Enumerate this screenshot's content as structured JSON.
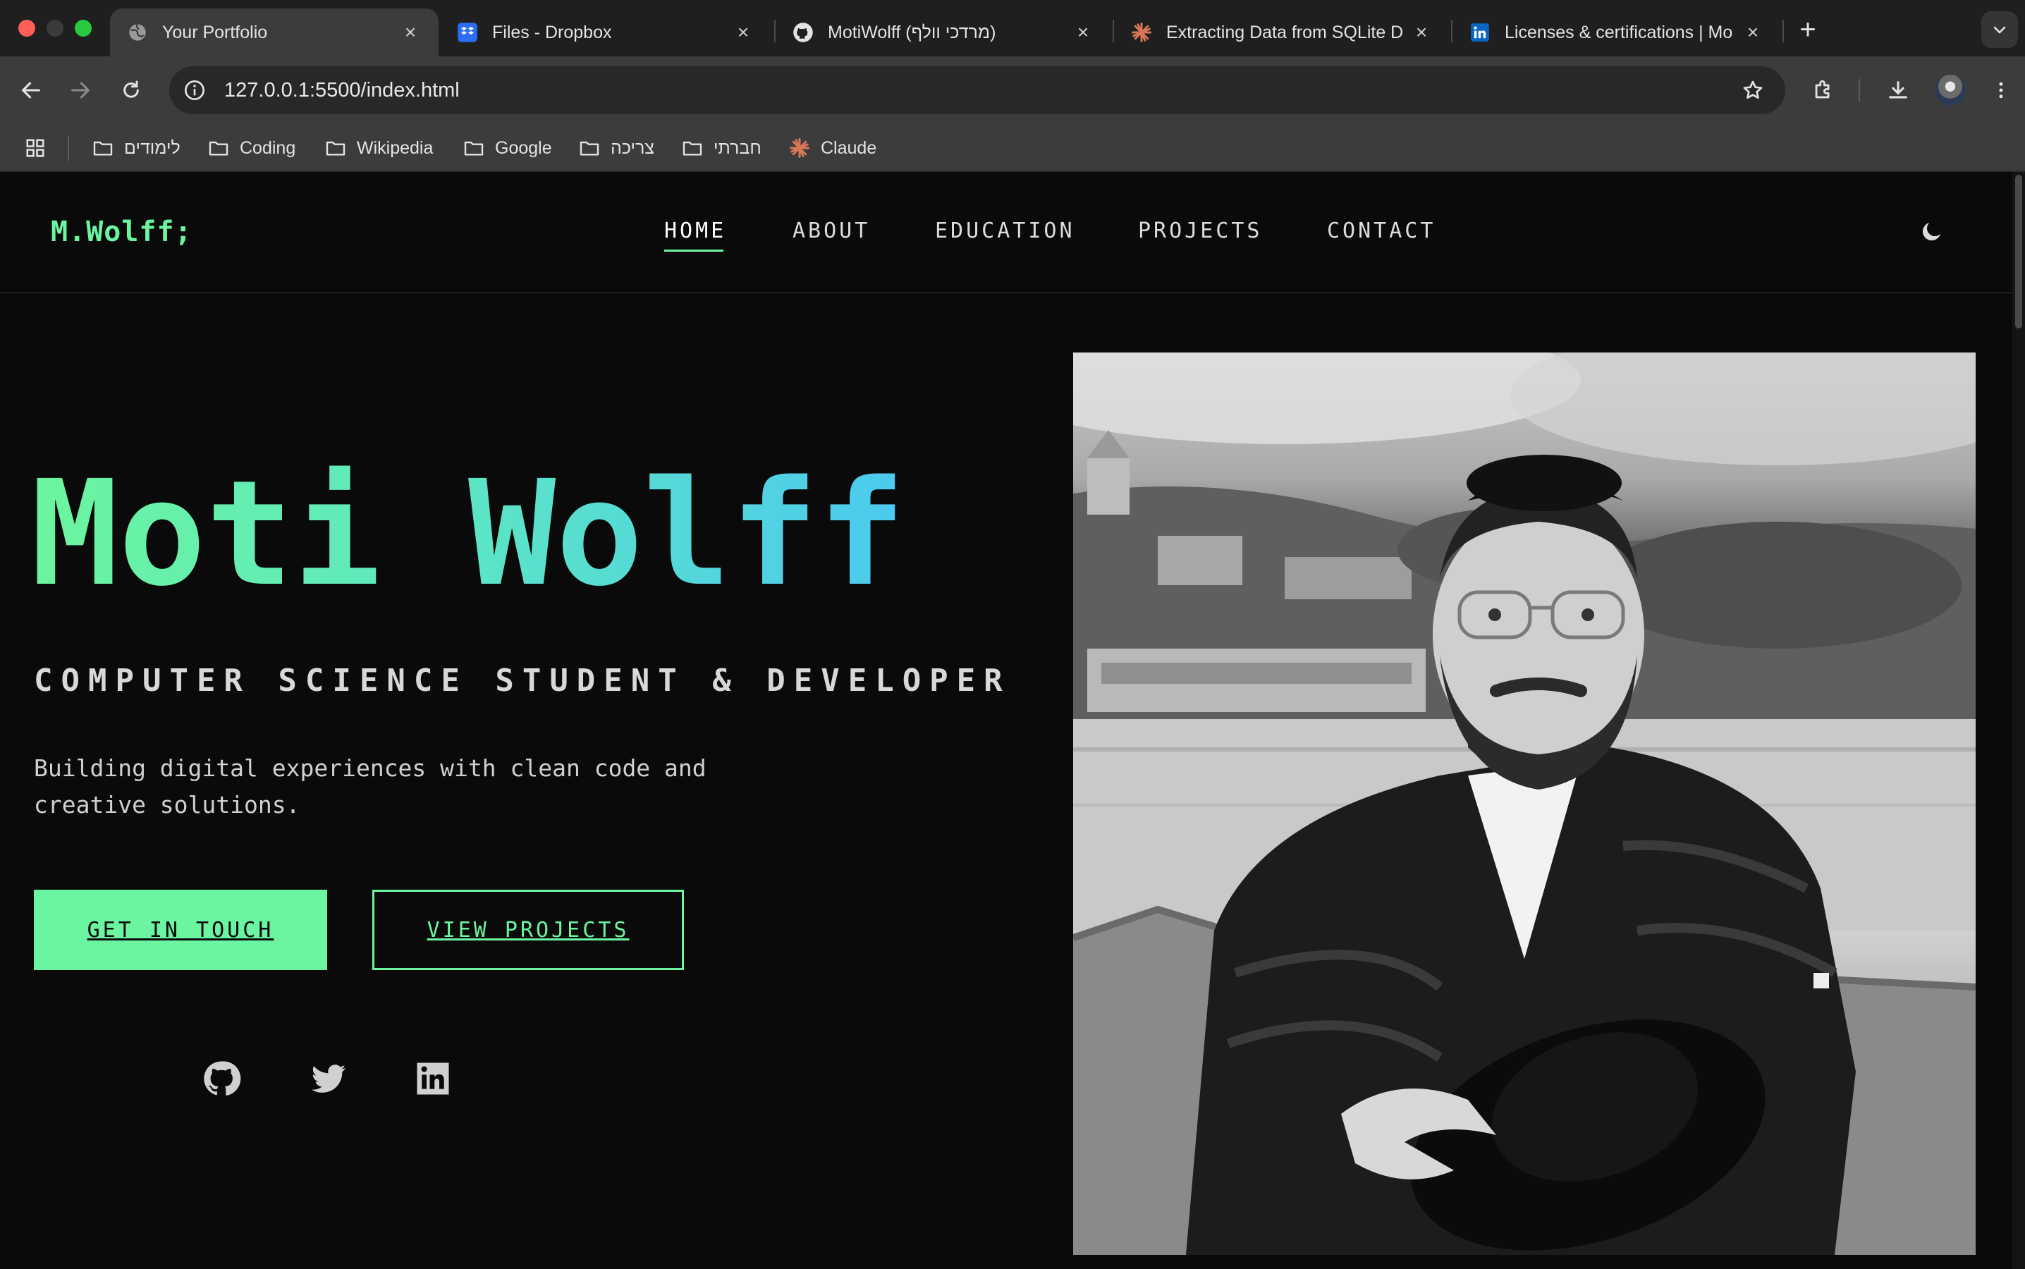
{
  "browser": {
    "tabs": [
      {
        "title": "Your Portfolio",
        "icon": "globe-icon",
        "active": true
      },
      {
        "title": "Files - Dropbox",
        "icon": "dropbox-icon",
        "active": false
      },
      {
        "title": "MotiWolff (מרדכי וולף)",
        "icon": "github-icon",
        "active": false
      },
      {
        "title": "Extracting Data from SQLite D",
        "icon": "claude-icon",
        "active": false
      },
      {
        "title": "Licenses & certifications | Mo",
        "icon": "linkedin-icon",
        "active": false
      }
    ],
    "url": "127.0.0.1:5500/index.html",
    "bookmarks": [
      {
        "label": "לימודים",
        "icon": "folder-icon"
      },
      {
        "label": "Coding",
        "icon": "folder-icon"
      },
      {
        "label": "Wikipedia",
        "icon": "folder-icon"
      },
      {
        "label": "Google",
        "icon": "folder-icon"
      },
      {
        "label": "צריכה",
        "icon": "folder-icon"
      },
      {
        "label": "חברתי",
        "icon": "folder-icon"
      },
      {
        "label": "Claude",
        "icon": "claude-icon"
      }
    ]
  },
  "site": {
    "logo": "M.Wolff;",
    "nav": [
      {
        "label": "HOME",
        "active": true
      },
      {
        "label": "ABOUT",
        "active": false
      },
      {
        "label": "EDUCATION",
        "active": false
      },
      {
        "label": "PROJECTS",
        "active": false
      },
      {
        "label": "CONTACT",
        "active": false
      }
    ],
    "theme_toggle_icon": "moon-icon",
    "hero": {
      "name": "Moti Wolff",
      "subtitle": "COMPUTER SCIENCE STUDENT & DEVELOPER",
      "description": "Building digital experiences with clean code and creative solutions.",
      "primary_button": "GET IN TOUCH",
      "secondary_button": "VIEW PROJECTS",
      "social_icons": [
        "github-icon",
        "twitter-icon",
        "linkedin-icon"
      ]
    },
    "colors": {
      "accent": "#6cf5a0",
      "gradient_end": "#4cc9f0",
      "background": "#0a0a0a"
    }
  }
}
